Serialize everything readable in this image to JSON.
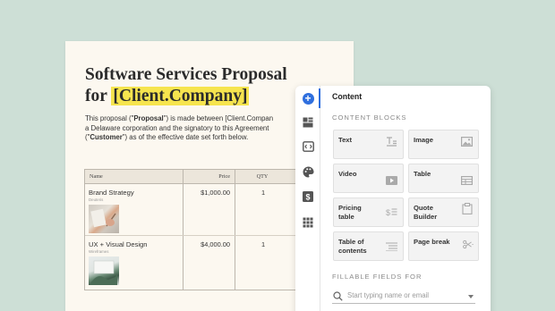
{
  "document": {
    "title_line1": "Software Services Proposal",
    "title_for": "for",
    "title_placeholder": "[Client.Company]",
    "intro_line1_pre": "This proposal (\"",
    "intro_line1_bold": "Proposal",
    "intro_line1_post": "\") is made between [Client.Compan",
    "intro_line2": "a Delaware corporation and the signatory to this Agreement",
    "intro_line3_pre": "(\"",
    "intro_line3_bold": "Customer",
    "intro_line3_post": "\") as of the effective date set forth below.",
    "table": {
      "headers": {
        "name": "Name",
        "price": "Price",
        "qty": "QTY"
      },
      "rows": [
        {
          "title": "Brand Strategy",
          "subtitle": "Deuteris",
          "price": "$1,000.00",
          "qty": "1"
        },
        {
          "title": "UX + Visual Design",
          "subtitle": "Wireframes",
          "price": "$4,000.00",
          "qty": "1"
        }
      ]
    }
  },
  "panel": {
    "title": "Content",
    "content_blocks_label": "CONTENT BLOCKS",
    "blocks": [
      {
        "label": "Text",
        "icon": "text-icon"
      },
      {
        "label": "Image",
        "icon": "image-icon"
      },
      {
        "label": "Video",
        "icon": "video-play-icon"
      },
      {
        "label": "Table",
        "icon": "table-icon"
      },
      {
        "label": "Pricing table",
        "icon": "pricing-table-icon"
      },
      {
        "label": "Quote Builder",
        "icon": "quote-builder-icon"
      },
      {
        "label": "Table of contents",
        "icon": "toc-list-icon"
      },
      {
        "label": "Page break",
        "icon": "scissors-icon"
      }
    ],
    "fillable_label": "FILLABLE FIELDS FOR",
    "search_placeholder": "Start typing name or email"
  },
  "rail": {
    "icons": [
      "add-content-icon",
      "blocks-layout-icon",
      "variables-icon",
      "palette-icon",
      "pricing-dollar-icon",
      "apps-grid-icon"
    ]
  },
  "colors": {
    "background": "#cddfd6",
    "highlight": "#f6e44e",
    "accent": "#2f6fde"
  }
}
